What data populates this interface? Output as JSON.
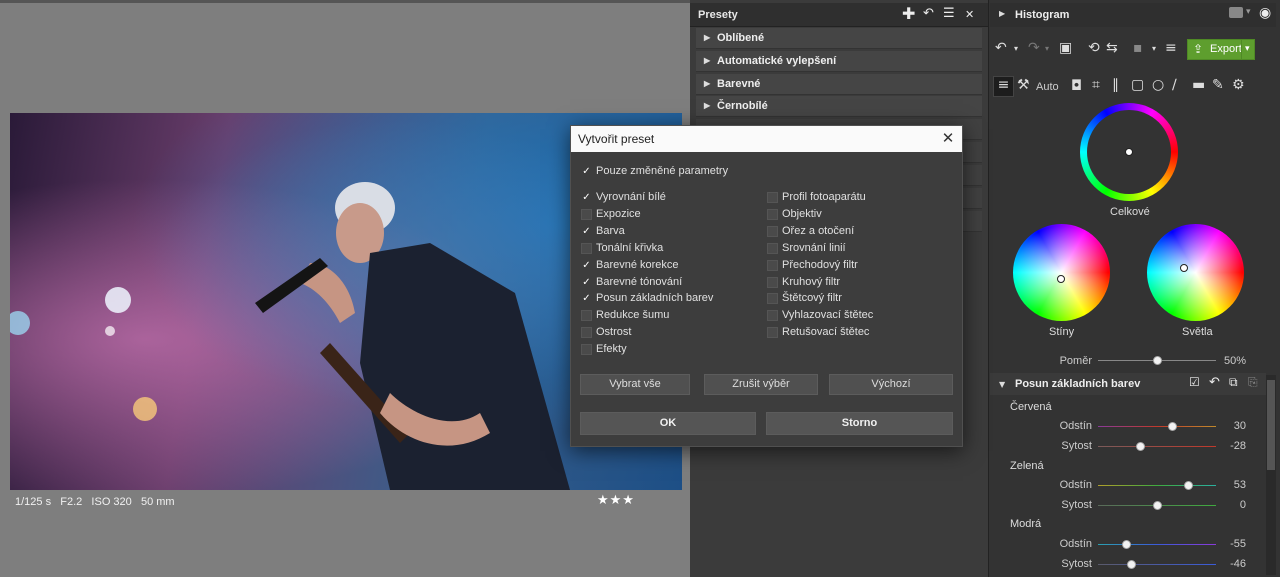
{
  "viewer": {
    "meta": "1/125 s   F2.2   ISO 320   50 mm",
    "rating": "★★★"
  },
  "presets": {
    "title": "Presety",
    "rows": [
      "Oblíbené",
      "Automatické vylepšení",
      "Barevné",
      "Černobílé"
    ]
  },
  "histogram": {
    "title": "Histogram"
  },
  "toolbar": {
    "export_label": "Export",
    "auto_label": "Auto"
  },
  "wheels": {
    "overall_label": "Celkové",
    "shadows_label": "Stíny",
    "highlights_label": "Světla"
  },
  "ratio": {
    "label": "Poměr",
    "value": "50%",
    "level": 0.5
  },
  "color_shift": {
    "title": "Posun základních barev",
    "groups": [
      {
        "name": "Červená",
        "hue_label": "Odstín",
        "hue_value": "30",
        "hue_level": 0.63,
        "sat_label": "Sytost",
        "sat_value": "-28",
        "sat_level": 0.36
      },
      {
        "name": "Zelená",
        "hue_label": "Odstín",
        "hue_value": "53",
        "hue_level": 0.77,
        "sat_label": "Sytost",
        "sat_value": "0",
        "sat_level": 0.5
      },
      {
        "name": "Modrá",
        "hue_label": "Odstín",
        "hue_value": "-55",
        "hue_level": 0.24,
        "sat_label": "Sytost",
        "sat_value": "-46",
        "sat_level": 0.28
      }
    ]
  },
  "colors": {
    "accent_green": "#5e9e2e",
    "red": "#c0392b",
    "green": "#3faa3f",
    "blue": "#3b5bd9"
  },
  "dialog": {
    "title": "Vytvořit preset",
    "only_changed": {
      "label": "Pouze změněné parametry",
      "checked": true
    },
    "left": [
      {
        "label": "Vyrovnání bílé",
        "checked": true
      },
      {
        "label": "Expozice",
        "checked": false
      },
      {
        "label": "Barva",
        "checked": true
      },
      {
        "label": "Tonální křivka",
        "checked": false
      },
      {
        "label": "Barevné korekce",
        "checked": true
      },
      {
        "label": "Barevné tónování",
        "checked": true
      },
      {
        "label": "Posun základních barev",
        "checked": true
      },
      {
        "label": "Redukce šumu",
        "checked": false
      },
      {
        "label": "Ostrost",
        "checked": false
      },
      {
        "label": "Efekty",
        "checked": false
      }
    ],
    "right": [
      {
        "label": "Profil fotoaparátu",
        "checked": false
      },
      {
        "label": "Objektiv",
        "checked": false
      },
      {
        "label": "Ořez a otočení",
        "checked": false
      },
      {
        "label": "Srovnání linií",
        "checked": false
      },
      {
        "label": "Přechodový filtr",
        "checked": false
      },
      {
        "label": "Kruhový filtr",
        "checked": false
      },
      {
        "label": "Štětcový filtr",
        "checked": false
      },
      {
        "label": "Vyhlazovací štětec",
        "checked": false
      },
      {
        "label": "Retušovací štětec",
        "checked": false
      }
    ],
    "select_all": "Vybrat vše",
    "deselect": "Zrušit výběr",
    "default": "Výchozí",
    "ok": "OK",
    "cancel": "Storno"
  }
}
